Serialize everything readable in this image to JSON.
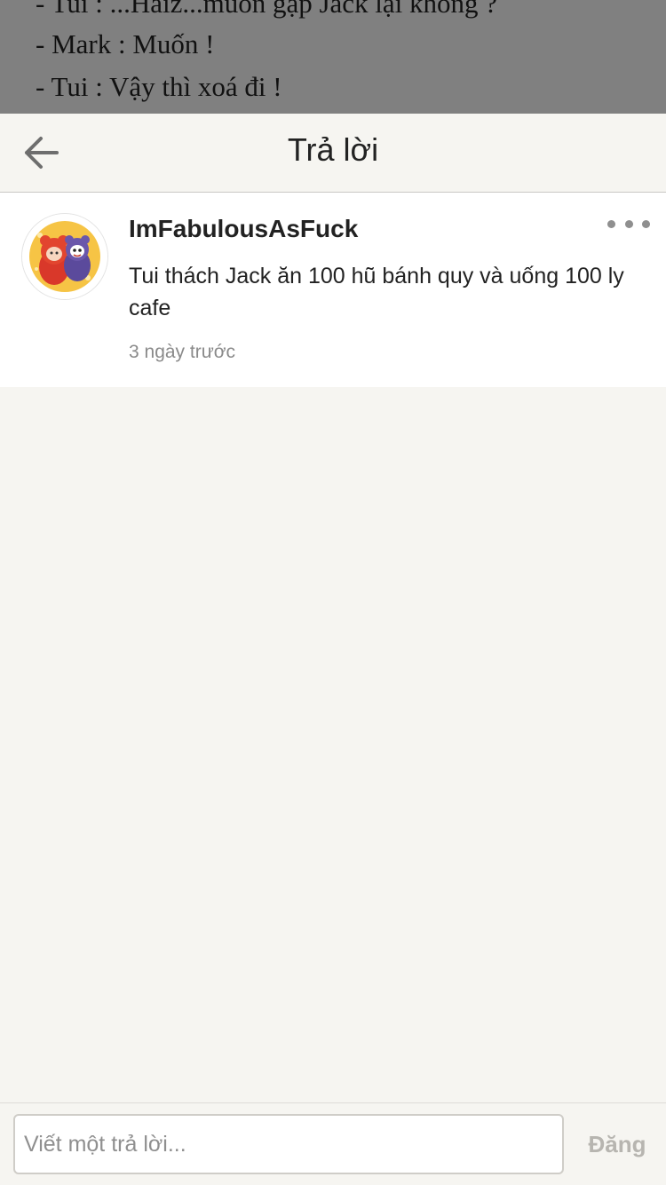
{
  "background_story": {
    "lines": [
      "- Tui : ...Haiz...muốn gặp Jack lại không ?",
      "- Mark : Muốn !",
      "- Tui : Vậy thì xoá đi !"
    ]
  },
  "header": {
    "title": "Trả lời",
    "back_icon": "arrow-left-icon"
  },
  "comment": {
    "username": "ImFabulousAsFuck",
    "text": "Tui thách Jack ăn 100 hũ bánh quy và uống 100 ly cafe",
    "timestamp": "3 ngày trước",
    "more_icon": "more-horizontal-icon"
  },
  "footer": {
    "input_placeholder": "Viết một trả lời...",
    "post_label": "Đăng"
  },
  "colors": {
    "background": "#f6f5f1",
    "overlay": "#808080",
    "text": "#222222",
    "muted": "#8a8a8a",
    "disabled_button": "#b7b5b0"
  }
}
